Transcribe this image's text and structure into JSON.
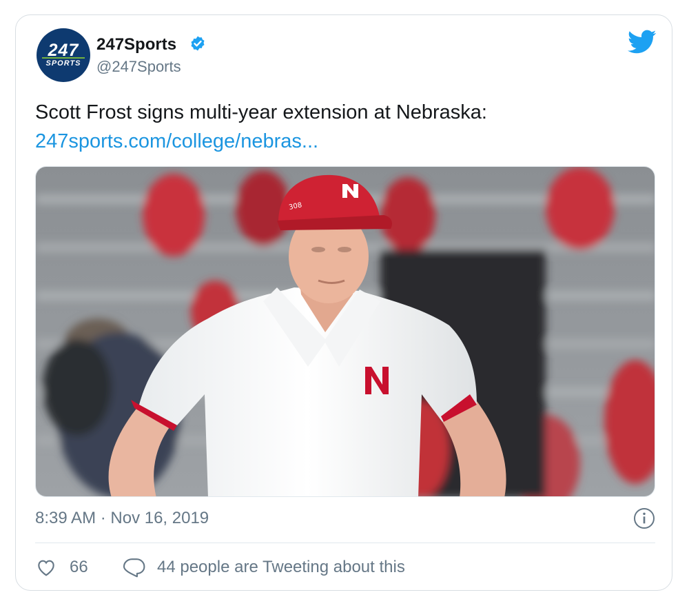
{
  "account": {
    "display_name": "247Sports",
    "handle": "@247Sports",
    "verified": true,
    "avatar_logo_text": "247",
    "avatar_logo_subtext": "SPORTS"
  },
  "tweet": {
    "text": "Scott Frost signs multi-year extension at Nebraska:",
    "link": "247sports.com/college/nebras...",
    "media_cap_text": "308",
    "timestamp": "8:39 AM · Nov 16, 2019"
  },
  "actions": {
    "likes": "66",
    "discussion": "44 people are Tweeting about this"
  },
  "icons": {
    "brand": "twitter-bird-icon",
    "verified": "verified-badge-icon",
    "info": "info-icon",
    "like": "heart-icon",
    "reply": "speech-bubble-icon"
  },
  "colors": {
    "accent": "#1da1f2",
    "link": "#1b95e0",
    "muted": "#657786",
    "nebraska_red": "#c8102e",
    "logo_navy": "#0e3a70",
    "logo_green": "#74b23f"
  }
}
